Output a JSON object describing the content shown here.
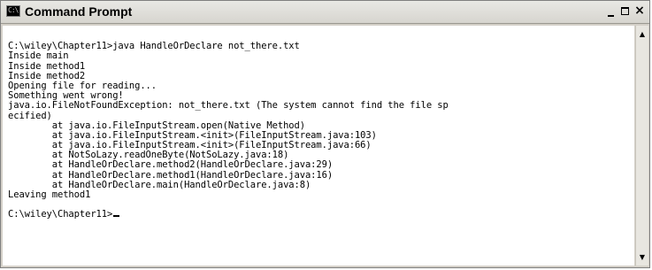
{
  "window": {
    "title": "Command Prompt",
    "icon_name": "cmd-window-icon",
    "icon_text": "C:\\",
    "controls": {
      "minimize": "minimize-icon",
      "maximize": "maximize-icon",
      "close": "close-icon",
      "close_glyph": "×"
    }
  },
  "console": {
    "lines": [
      "",
      "C:\\wiley\\Chapter11>java HandleOrDeclare not_there.txt",
      "Inside main",
      "Inside method1",
      "Inside method2",
      "Opening file for reading...",
      "Something went wrong!",
      "java.io.FileNotFoundException: not_there.txt (The system cannot find the file sp",
      "ecified)",
      "        at java.io.FileInputStream.open(Native Method)",
      "        at java.io.FileInputStream.<init>(FileInputStream.java:103)",
      "        at java.io.FileInputStream.<init>(FileInputStream.java:66)",
      "        at NotSoLazy.readOneByte(NotSoLazy.java:18)",
      "        at HandleOrDeclare.method2(HandleOrDeclare.java:29)",
      "        at HandleOrDeclare.method1(HandleOrDeclare.java:16)",
      "        at HandleOrDeclare.main(HandleOrDeclare.java:8)",
      "Leaving method1",
      "",
      "C:\\wiley\\Chapter11>"
    ]
  },
  "scrollbar": {
    "up_arrow": "▲",
    "down_arrow": "▼"
  }
}
